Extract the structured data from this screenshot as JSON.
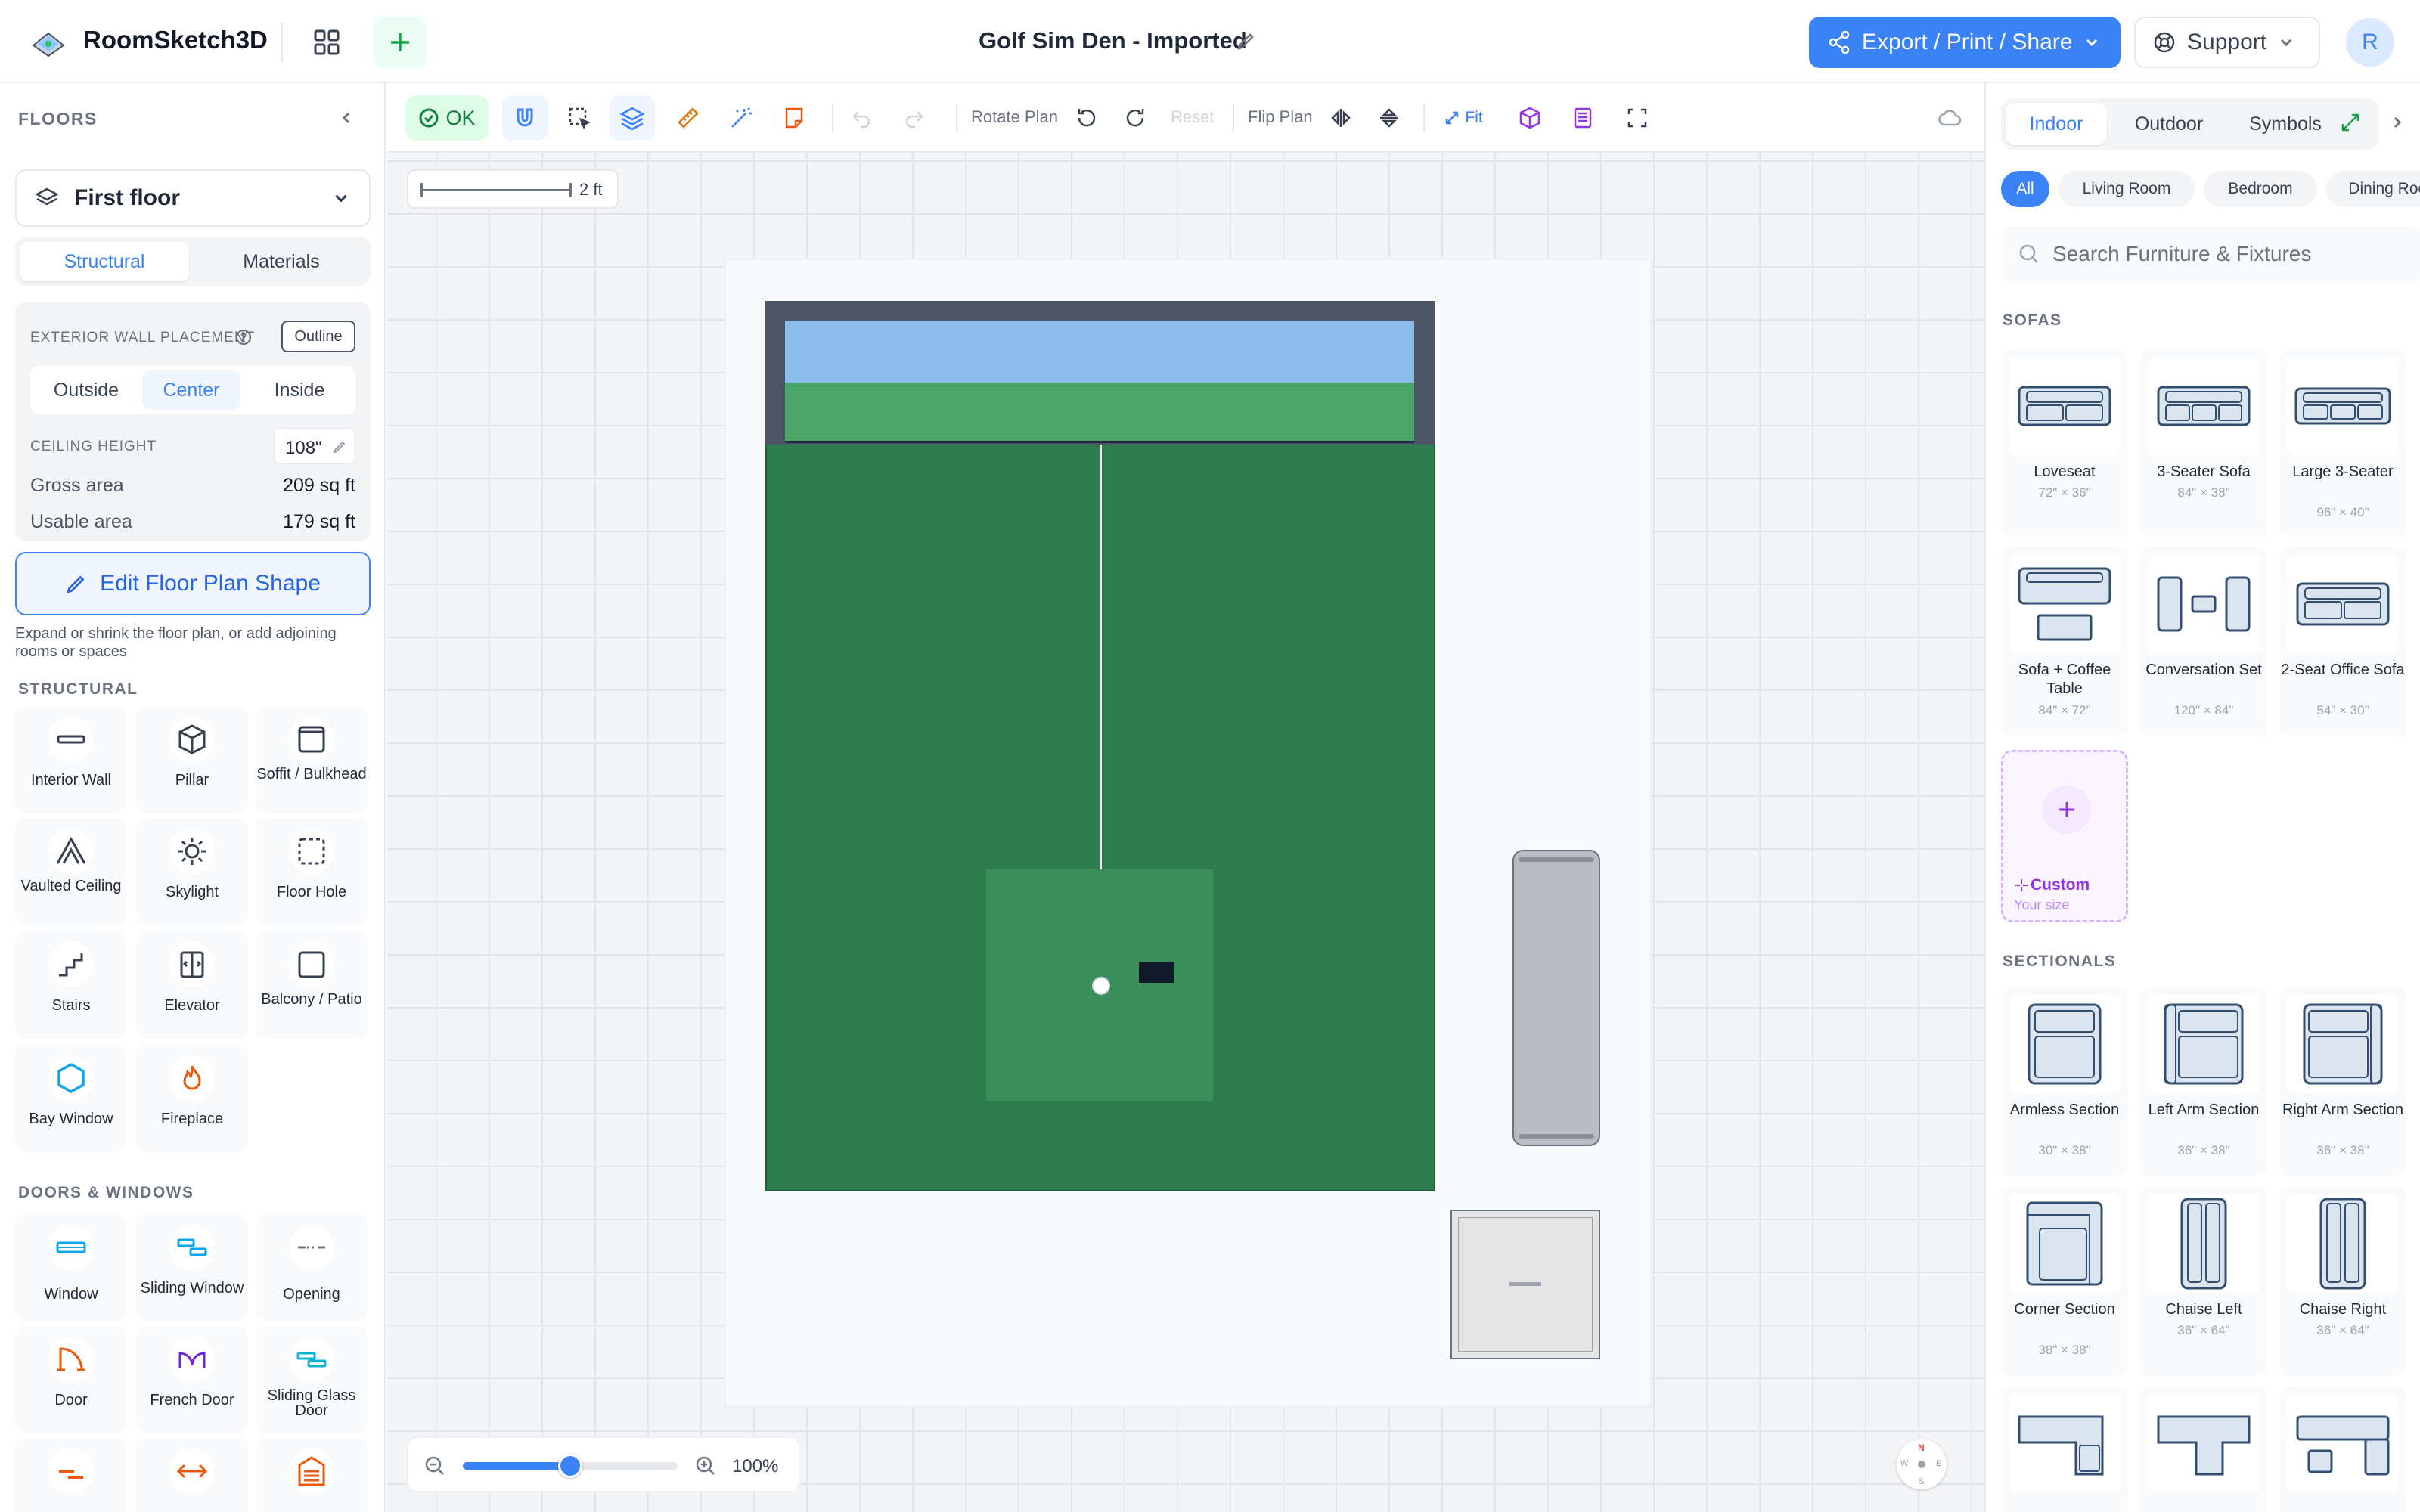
{
  "app": {
    "name": "RoomSketch3D",
    "document_title": "Golf Sim Den - Imported"
  },
  "header": {
    "export_label": "Export / Print / Share",
    "support_label": "Support",
    "avatar_initial": "R"
  },
  "floors": {
    "heading": "FLOORS",
    "selected_floor": "First floor",
    "tabs": [
      "Structural",
      "Materials"
    ],
    "active_tab": "Structural",
    "wall_placement_label": "EXTERIOR WALL PLACEMENT",
    "outline_label": "Outline",
    "placement_options": [
      "Outside",
      "Center",
      "Inside"
    ],
    "active_placement": "Center",
    "ceiling_label": "CEILING HEIGHT",
    "ceiling_value": "108\"",
    "gross_label": "Gross area",
    "gross_value": "209 sq ft",
    "usable_label": "Usable area",
    "usable_value": "179 sq ft",
    "edit_button": "Edit Floor Plan Shape",
    "edit_help": "Expand or shrink the floor plan, or add adjoining rooms or spaces"
  },
  "structural": {
    "heading": "STRUCTURAL",
    "items": [
      "Interior Wall",
      "Pillar",
      "Soffit / Bulkhead",
      "Vaulted Ceiling",
      "Skylight",
      "Floor Hole",
      "Stairs",
      "Elevator",
      "Balcony / Patio",
      "Bay Window",
      "Fireplace"
    ]
  },
  "doors_windows": {
    "heading": "DOORS & WINDOWS",
    "items": [
      "Window",
      "Sliding Window",
      "Opening",
      "Door",
      "French Door",
      "Sliding Glass Door"
    ]
  },
  "toolbar": {
    "status": "OK",
    "rotate_label": "Rotate Plan",
    "reset_label": "Reset",
    "flip_label": "Flip Plan",
    "fit_label": "Fit"
  },
  "canvas": {
    "scale_label": "2 ft",
    "zoom_value": 0.5,
    "zoom_label": "100%"
  },
  "compass": {
    "n": "N",
    "e": "E",
    "s": "S",
    "w": "W"
  },
  "library": {
    "tabs": [
      "Indoor",
      "Outdoor",
      "Symbols"
    ],
    "active_tab": "Indoor",
    "chips": [
      "All",
      "Living Room",
      "Bedroom",
      "Dining Room"
    ],
    "active_chip": "All",
    "search_placeholder": "Search Furniture & Fixtures",
    "sofas_heading": "SOFAS",
    "sofas": [
      {
        "name": "Loveseat",
        "dims": "72\" × 36\""
      },
      {
        "name": "3-Seater Sofa",
        "dims": "84\" × 38\""
      },
      {
        "name": "Large 3-Seater",
        "dims": "96\" × 40\""
      },
      {
        "name": "Sofa + Coffee Table",
        "dims": "84\" × 72\""
      },
      {
        "name": "Conversation Set",
        "dims": "120\" × 84\""
      },
      {
        "name": "2-Seat Office Sofa",
        "dims": "54\" × 30\""
      }
    ],
    "custom_label": "Custom",
    "custom_sub": "Your size",
    "sectionals_heading": "SECTIONALS",
    "sectionals": [
      {
        "name": "Armless Section",
        "dims": "30\" × 38\""
      },
      {
        "name": "Left Arm Section",
        "dims": "36\" × 38\""
      },
      {
        "name": "Right Arm Section",
        "dims": "36\" × 38\""
      },
      {
        "name": "Corner Section",
        "dims": "38\" × 38\""
      },
      {
        "name": "Chaise Left",
        "dims": "36\" × 64\""
      },
      {
        "name": "Chaise Right",
        "dims": "36\" × 64\""
      }
    ]
  },
  "colors": {
    "accent": "#3b82f6",
    "turf": "#2e7d4f",
    "sky": "#8bbbe8",
    "wall": "#4b5563"
  }
}
